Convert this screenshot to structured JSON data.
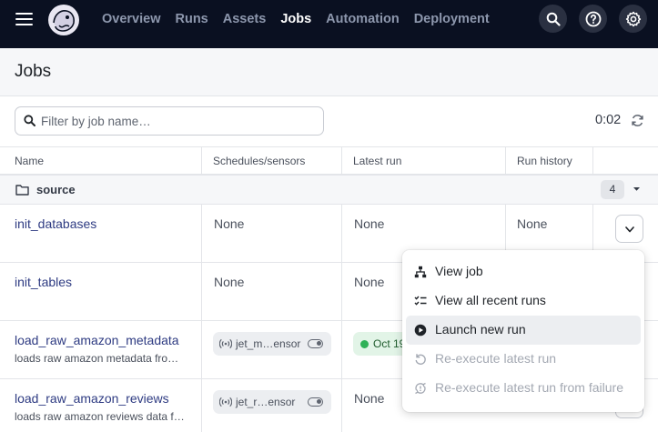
{
  "nav": {
    "items": [
      {
        "label": "Overview",
        "active": false
      },
      {
        "label": "Runs",
        "active": false
      },
      {
        "label": "Assets",
        "active": false
      },
      {
        "label": "Jobs",
        "active": true
      },
      {
        "label": "Automation",
        "active": false
      },
      {
        "label": "Deployment",
        "active": false
      }
    ],
    "icons": [
      "search-icon",
      "help-icon",
      "settings-icon"
    ]
  },
  "page": {
    "title": "Jobs"
  },
  "filter": {
    "placeholder": "Filter by job name…",
    "value": ""
  },
  "refresh": {
    "countdown": "0:02"
  },
  "table": {
    "columns": [
      "Name",
      "Schedules/sensors",
      "Latest run",
      "Run history"
    ],
    "group": {
      "name": "source",
      "count": "4"
    },
    "rows": [
      {
        "name": "init_databases",
        "description": "",
        "schedule": "None",
        "latest_run": "None",
        "run_history": "None"
      },
      {
        "name": "init_tables",
        "description": "",
        "schedule": "None",
        "latest_run": "None",
        "run_history": ""
      },
      {
        "name": "load_raw_amazon_metadata",
        "description": "loads raw amazon metadata fro…",
        "sensor": "jet_m…ensor",
        "latest_run": "Oct 19",
        "run_history": ""
      },
      {
        "name": "load_raw_amazon_reviews",
        "description": "loads raw amazon reviews data f…",
        "sensor": "jet_r…ensor",
        "latest_run": "None",
        "run_history": ""
      }
    ]
  },
  "menu": {
    "items": [
      {
        "label": "View job",
        "icon": "hierarchy-icon",
        "disabled": false
      },
      {
        "label": "View all recent runs",
        "icon": "checklist-icon",
        "disabled": false
      },
      {
        "label": "Launch new run",
        "icon": "play-icon",
        "disabled": false,
        "hover": true
      },
      {
        "label": "Re-execute latest run",
        "icon": "replay-icon",
        "disabled": true
      },
      {
        "label": "Re-execute latest run from failure",
        "icon": "sync-problem-icon",
        "disabled": true
      }
    ]
  },
  "colors": {
    "topbar": "#0a1021",
    "link": "#2e3b82",
    "success": "#2fb157"
  }
}
